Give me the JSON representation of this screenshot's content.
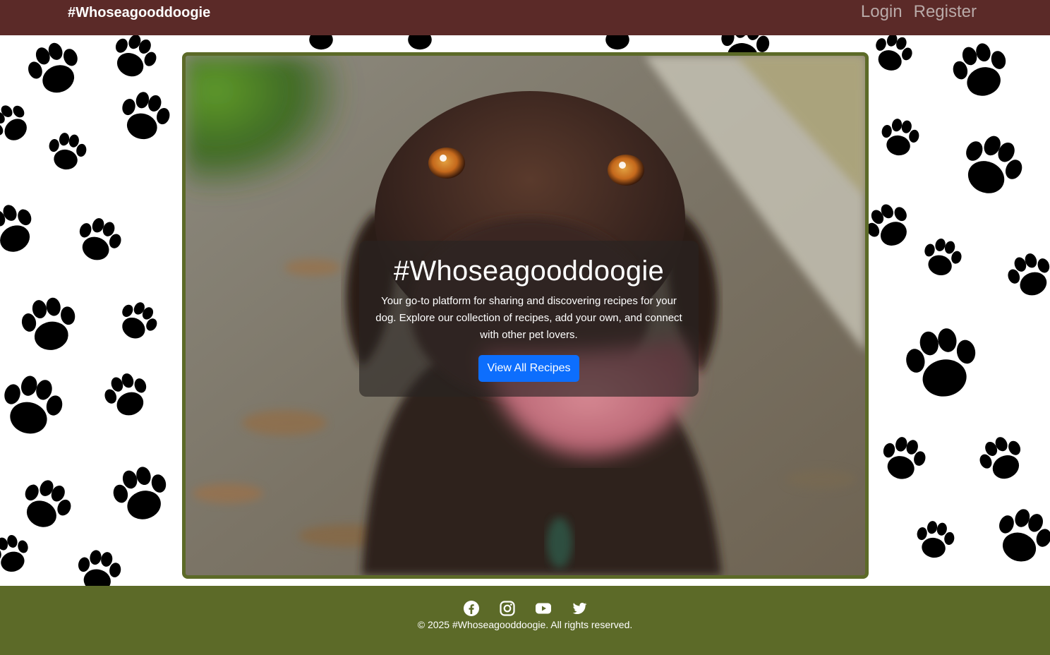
{
  "nav": {
    "brand": "#Whoseagooddoogie",
    "links": [
      {
        "label": "Login"
      },
      {
        "label": "Register"
      }
    ]
  },
  "hero": {
    "title": "#Whoseagooddoogie",
    "text": "Your go-to platform for sharing and discovering recipes for your dog. Explore our collection of recipes, add your own, and connect with other pet lovers.",
    "button_label": "View All Recipes"
  },
  "footer": {
    "social": [
      {
        "icon": "facebook-icon"
      },
      {
        "icon": "instagram-icon"
      },
      {
        "icon": "youtube-icon"
      },
      {
        "icon": "twitter-icon"
      }
    ],
    "copyright": "© 2025 #Whoseagooddoogie. All rights reserved."
  },
  "colors": {
    "navbar": "#5b2a28",
    "footer": "#5c6a28",
    "card_border": "#5c6a28",
    "button": "#0d6efd"
  }
}
